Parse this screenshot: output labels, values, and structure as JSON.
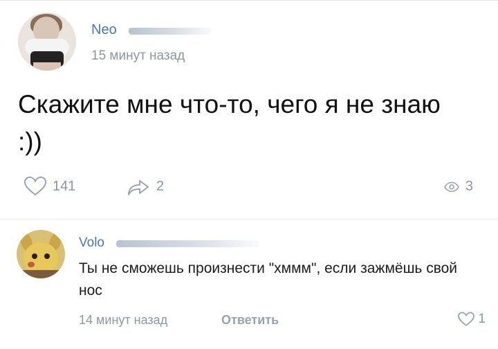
{
  "post": {
    "author": "Neo",
    "time": "15 минут назад",
    "text": "Скажите мне что-то, чего я не знаю :))",
    "likes": "141",
    "shares": "2",
    "views": "3"
  },
  "comment": {
    "author": "Volo",
    "text": "Ты не сможешь произнести \"хммм\", если зажмёшь свой нос",
    "time": "14 минут назад",
    "reply_label": "Ответить",
    "likes": "1"
  },
  "colors": {
    "name_link": "#4a76a8",
    "muted": "#8c96a1"
  },
  "icons": {
    "like": "heart-icon",
    "share": "share-arrow-icon",
    "views": "eye-icon"
  }
}
